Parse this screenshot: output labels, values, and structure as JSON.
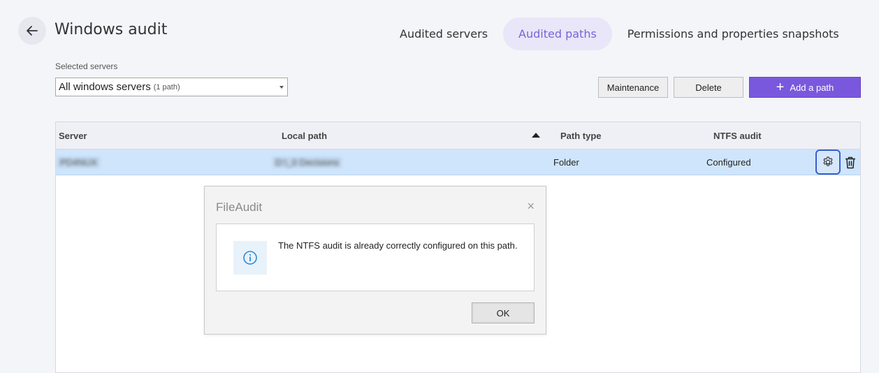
{
  "header": {
    "title": "Windows audit",
    "back_icon": "arrow-left-icon"
  },
  "tabs": [
    {
      "label": "Audited servers",
      "active": false
    },
    {
      "label": "Audited paths",
      "active": true
    },
    {
      "label": "Permissions and properties snapshots",
      "active": false
    }
  ],
  "filter": {
    "label": "Selected servers",
    "value": "All windows servers",
    "count": "(1 path)"
  },
  "toolbar": {
    "maintenance_label": "Maintenance",
    "delete_label": "Delete",
    "add_label": "Add a path"
  },
  "table": {
    "columns": [
      "Server",
      "Local path",
      "Path type",
      "NTFS audit"
    ],
    "sort_column": "Local path",
    "rows": [
      {
        "server": "PD4NUX",
        "local_path": "D:\\_0 Decisions",
        "path_type": "Folder",
        "ntfs_audit": "Configured"
      }
    ]
  },
  "dialog": {
    "title": "FileAudit",
    "close_label": "×",
    "message": "The NTFS audit is already correctly configured on this path.",
    "ok_label": "OK"
  },
  "colors": {
    "accent": "#7a58dd",
    "active_tab_bg": "#e8e6f8",
    "active_tab_text": "#7b63d8",
    "row_selected": "#cfe5fb",
    "focus_border": "#3a5fcf"
  }
}
